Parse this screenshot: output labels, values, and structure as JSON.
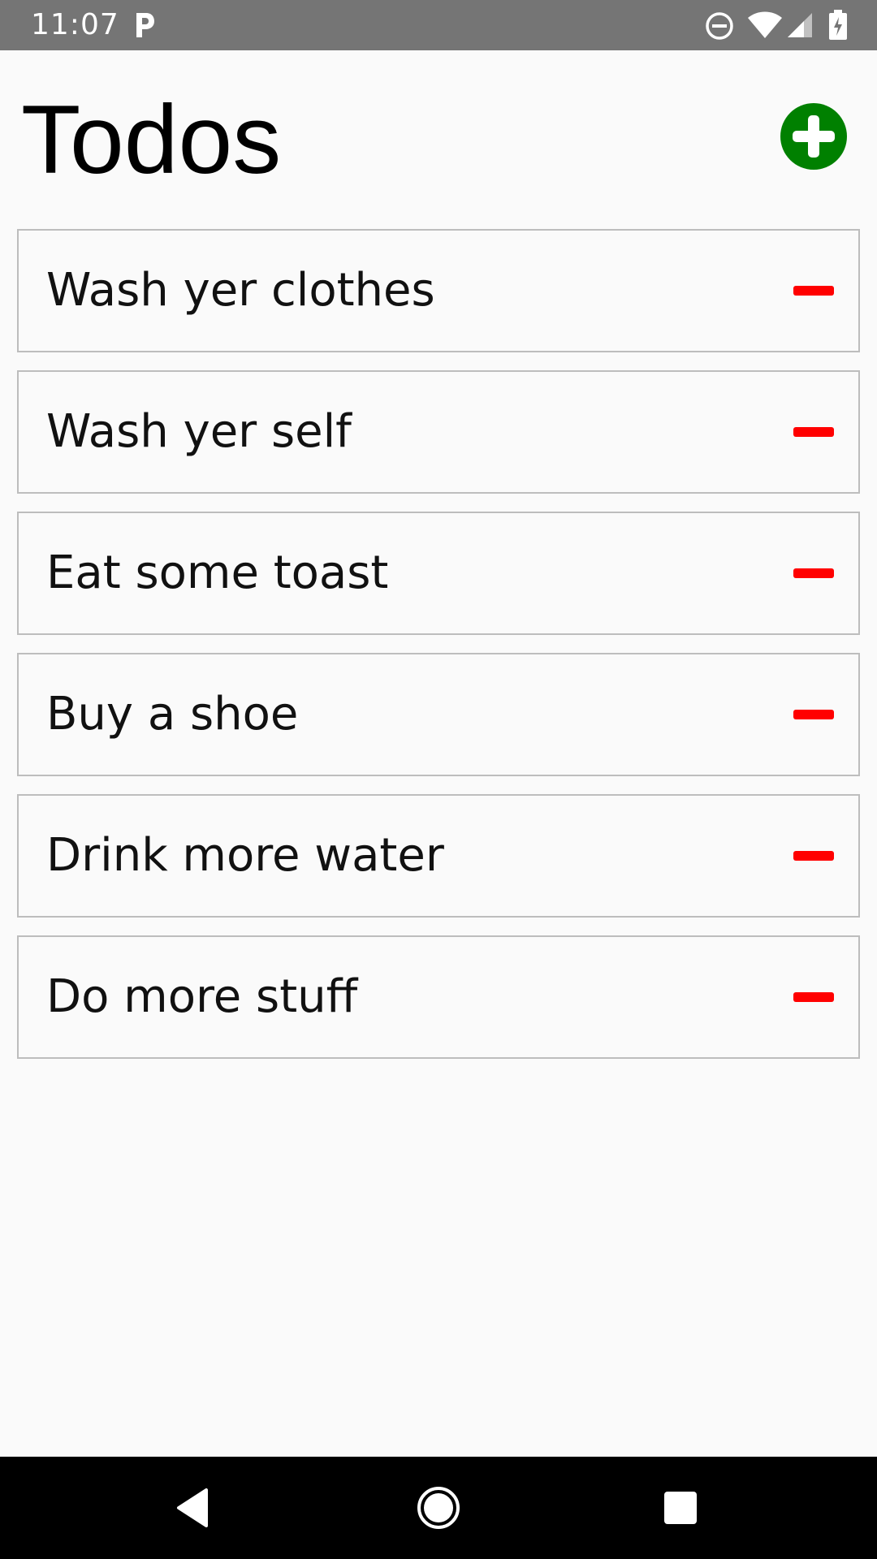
{
  "status_bar": {
    "time": "11:07",
    "icons": [
      "parking-icon",
      "do-not-disturb-icon",
      "wifi-icon",
      "signal-icon",
      "battery-icon"
    ]
  },
  "header": {
    "title": "Todos",
    "add_icon": "plus-circle-icon"
  },
  "todos": [
    {
      "label": "Wash yer clothes",
      "remove_icon": "minus-icon"
    },
    {
      "label": "Wash yer self",
      "remove_icon": "minus-icon"
    },
    {
      "label": "Eat some toast",
      "remove_icon": "minus-icon"
    },
    {
      "label": "Buy a shoe",
      "remove_icon": "minus-icon"
    },
    {
      "label": "Drink more water",
      "remove_icon": "minus-icon"
    },
    {
      "label": "Do more stuff",
      "remove_icon": "minus-icon"
    }
  ],
  "nav_bar": {
    "icons": [
      "back-icon",
      "home-icon",
      "recents-icon"
    ]
  },
  "colors": {
    "status_bar_bg": "#757575",
    "add_button": "#008000",
    "remove_button": "#ff0000",
    "item_border": "#bdbdbd",
    "nav_bar_bg": "#000000"
  }
}
